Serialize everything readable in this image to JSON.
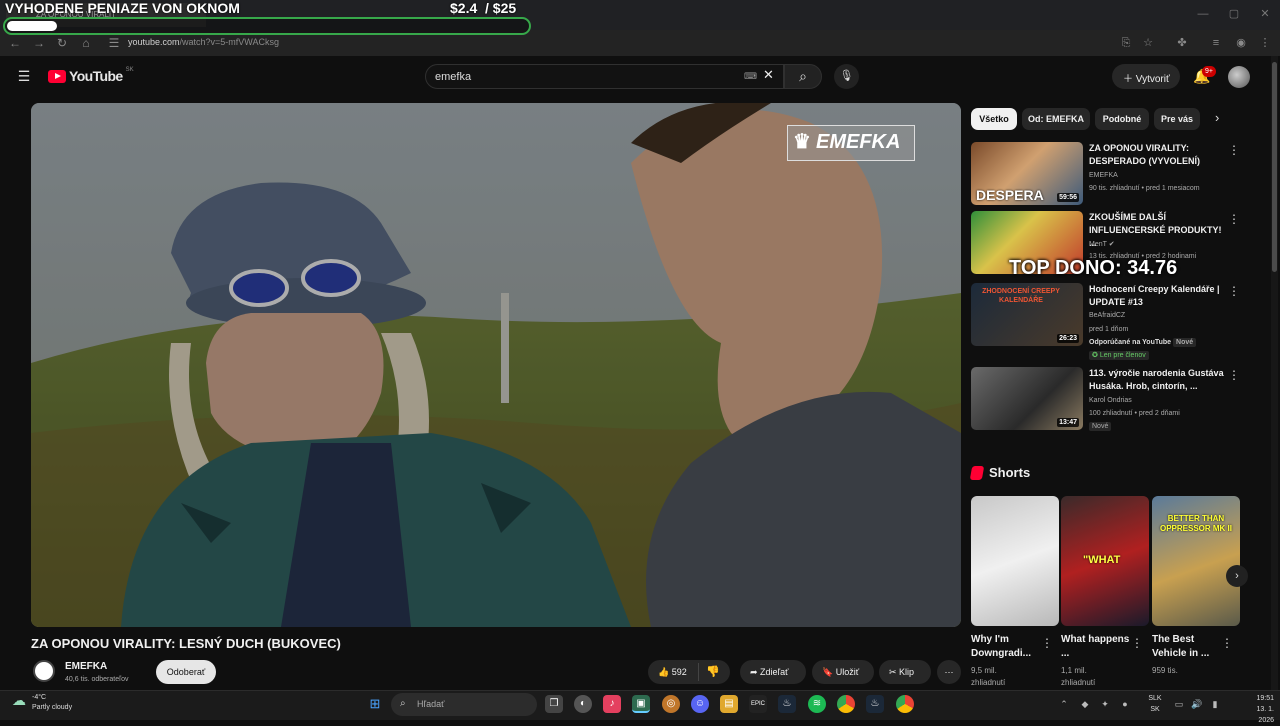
{
  "overlay": {
    "title": "VYHODENE PENIAZE VON OKNOM",
    "amount": "$2.4",
    "goal": "/ $25",
    "progress": 0.096,
    "top_dono": "TOP DONO: 34.76"
  },
  "browser": {
    "tab_title": "ZA OPONOU VIRALIT",
    "url_host": "youtube.com",
    "url_path": "/watch?v=5-mfVWACksg"
  },
  "youtube": {
    "logo": "YouTube",
    "country": "SK",
    "search_value": "emefka",
    "create_label": "Vytvoriť",
    "notif_badge": "9+"
  },
  "video": {
    "watermark": "EMEFKA",
    "title": "ZA OPONOU VIRALITY: LESNÝ DUCH (BUKOVEC)",
    "channel": "EMEFKA",
    "subscribers": "40,6 tis. odberateľov",
    "subscribe_label": "Odoberať",
    "likes": "592",
    "share_label": "Zdieľať",
    "save_label": "Uložiť",
    "clip_label": "Klip"
  },
  "chips": [
    "Všetko",
    "Od: EMEFKA",
    "Podobné",
    "Pre vás"
  ],
  "recommendations": [
    {
      "title": "ZA OPONOU VIRALITY: DESPERADO (VYVOLENÍ)",
      "channel": "EMEFKA",
      "meta": "90 tis. zhliadnutí • pred 1 mesiacom",
      "duration": "59:56",
      "thumb_text": "DESPERA"
    },
    {
      "title": "ZKOUŠÍME DALŠÍ INFLUENCERSKÉ PRODUKTY! ...",
      "channel": "MenT",
      "meta": "13 tis. zhliadnutí • pred 2 hodinami",
      "duration": "",
      "thumb_text": ""
    },
    {
      "title": "Hodnocení Creepy Kalendáře | UPDATE #13",
      "channel": "BeAfraidCZ",
      "meta": "pred 1 dňom",
      "duration": "26:23",
      "recommended": "Odporúčané na YouTube",
      "new_tag": "Nové",
      "members_tag": "Len pre členov",
      "thumb_text": "ZHODNOCENÍ CREEPY KALENDÁŘE"
    },
    {
      "title": "113. výročie narodenia Gustáva Husáka. Hrob, cintorín, ...",
      "channel": "Karol Ondrias",
      "meta": "100 zhliadnutí • pred 2 dňami",
      "duration": "13:47",
      "new_tag": "Nové",
      "thumb_text": ""
    }
  ],
  "shorts": {
    "header": "Shorts",
    "items": [
      {
        "title": "Why I'm Downgradi...",
        "views": "9,5 mil. zhliadnutí",
        "thumb_text": ""
      },
      {
        "title": "What happens ...",
        "views": "1,1 mil. zhliadnutí",
        "thumb_text": "\"WHAT"
      },
      {
        "title": "The Best Vehicle in ...",
        "views": "959 tis.",
        "thumb_text": "BETTER THAN OPPRESSOR MK II"
      }
    ]
  },
  "taskbar": {
    "temp": "-4°C",
    "weather": "Partly cloudy",
    "search_placeholder": "Hľadať",
    "lang1": "SLK",
    "lang2": "SK",
    "time": "19:51",
    "date": "13. 1. 2026"
  }
}
